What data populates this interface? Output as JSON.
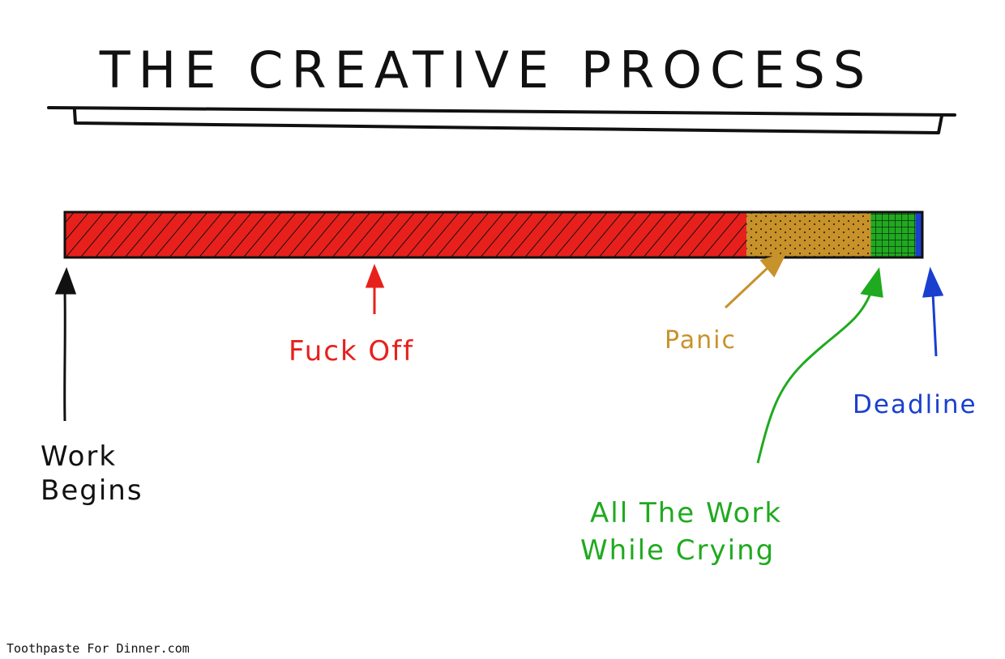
{
  "title": "THE CREATIVE PROCESS",
  "timeline": [
    {
      "label": "Fuck Off",
      "share": 0.795,
      "color": "#e8201c",
      "pattern": "diagonal-hatch"
    },
    {
      "label": "Panic",
      "share": 0.145,
      "color": "#c8922a",
      "pattern": "dots"
    },
    {
      "label": "All The Work While Crying",
      "share": 0.052,
      "color": "#1faa1f",
      "pattern": "grid"
    },
    {
      "label": "Deadline",
      "share": 0.008,
      "color": "#1a3fcf",
      "pattern": "solid"
    }
  ],
  "labels": {
    "work_begins": {
      "lines": [
        "Work",
        "Begins"
      ],
      "color": "#111111"
    },
    "fuck_off": {
      "text": "Fuck Off",
      "color": "#e8201c"
    },
    "panic": {
      "text": "Panic",
      "color": "#c8922a"
    },
    "all_the_work": {
      "lines": [
        "All The Work",
        "While Crying"
      ],
      "color": "#1faa1f"
    },
    "deadline": {
      "text": "Deadline",
      "color": "#1a3fcf"
    }
  },
  "credit": "Toothpaste For Dinner.com"
}
